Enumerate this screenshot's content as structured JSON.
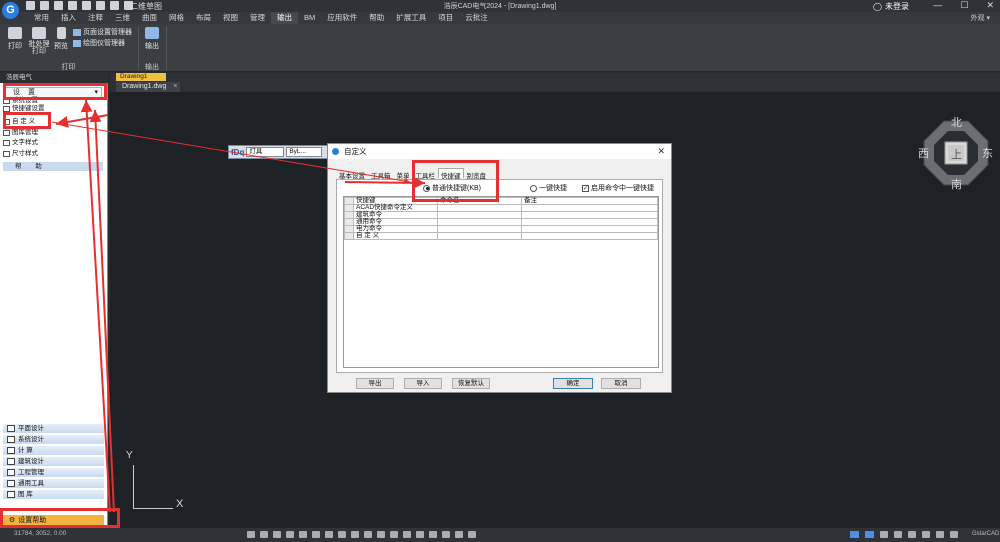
{
  "titlebar": {
    "window_title": "浩辰CAD电气2024 - [Drawing1.dwg]",
    "workspace": "二维草图",
    "login": "未登录",
    "controls": [
      "—",
      "☐",
      "✕"
    ]
  },
  "menu": {
    "tabs": [
      "常用",
      "插入",
      "注释",
      "三维",
      "曲面",
      "网格",
      "布局",
      "视图",
      "管理",
      "输出",
      "BM",
      "应用软件",
      "帮助",
      "扩展工具",
      "项目",
      "云批注"
    ],
    "active": "输出",
    "right": "外观 ▾"
  },
  "ribbon": {
    "print": "打印",
    "batch_print": "批处理打印",
    "preview": "预览",
    "page_setup": "页面设置管理器",
    "plotter_mgr": "绘图仪管理器",
    "group_print": "打印",
    "output": "输出",
    "group_output": "输出"
  },
  "doc": {
    "top_tab": "Drawing1",
    "tab": "Drawing1.dwg",
    "tab_close": "×"
  },
  "leftpanel": {
    "header": "浩辰电气",
    "dropdown": "设 置",
    "dropdown_arrow": "▾",
    "items": [
      "系统设置",
      "快捷键设置",
      "自 定 义",
      "图库管理",
      "文字样式",
      "尺寸样式"
    ],
    "help": "帮 助",
    "categories": [
      "平面设计",
      "系统设计",
      "计 算",
      "建筑设计",
      "工程管理",
      "通用工具",
      "图 库"
    ],
    "setting_help": "设置帮助"
  },
  "viewcube": {
    "north": "北",
    "south": "南",
    "east": "东",
    "west": "西",
    "top": "上"
  },
  "ucs": {
    "x": "X",
    "y": "Y"
  },
  "float_toolbar": {
    "logo": "fDq",
    "layer": "灯具",
    "linetype": "ByL..."
  },
  "dialog": {
    "title": "自定义",
    "close": "✕",
    "tabs": [
      "基本设置",
      "工具箱",
      "菜单",
      "工具栏",
      "快捷键",
      "别览盘"
    ],
    "active_tab": "快捷键",
    "radio_normal": "普通快捷键(KB)",
    "radio_one_key": "一键快捷",
    "checkbox_enable": "启用命令中一键快捷",
    "columns": [
      "快捷键",
      "命令名",
      "备注"
    ],
    "rows": [
      "ACAD快捷命令定义",
      "建筑命令",
      "通用命令",
      "电力命令",
      "自 定 义"
    ],
    "buttons": {
      "export": "导出",
      "import": "导入",
      "reset": "恢复默认",
      "ok": "确定",
      "cancel": "取消"
    }
  },
  "status": {
    "coords": "31784, 3052, 0.00",
    "brand": "GstarCAD"
  }
}
